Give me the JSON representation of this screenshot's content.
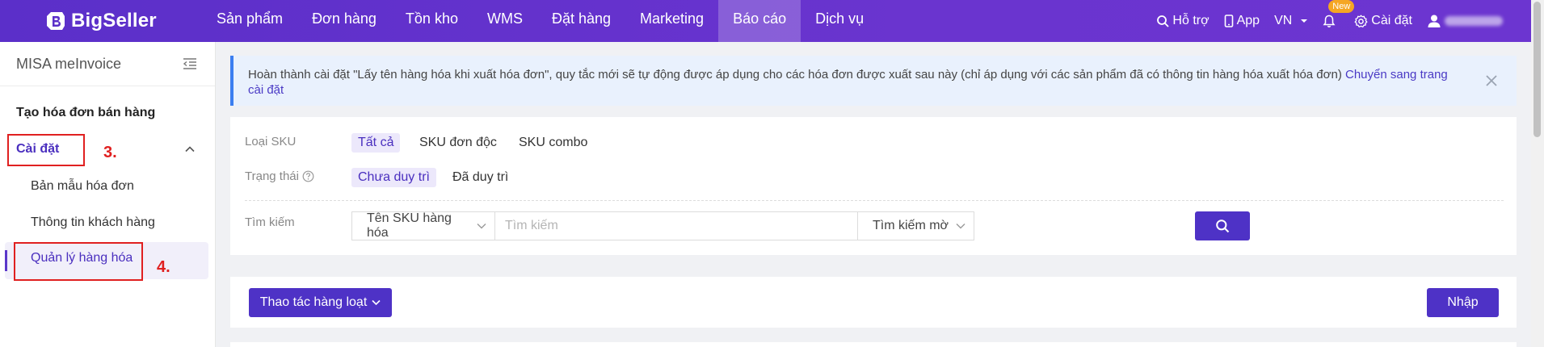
{
  "app": {
    "brand": "BigSeller"
  },
  "nav": {
    "items": [
      "Sản phẩm",
      "Đơn hàng",
      "Tồn kho",
      "WMS",
      "Đặt hàng",
      "Marketing",
      "Báo cáo",
      "Dịch vụ"
    ],
    "active": "Báo cáo"
  },
  "tools": {
    "support": "Hỗ trợ",
    "app": "App",
    "language": "VN",
    "new_badge": "New",
    "settings": "Cài đặt"
  },
  "sidebar": {
    "title": "MISA meInvoice",
    "section": "Tạo hóa đơn bán hàng",
    "group": "Cài đặt",
    "items": [
      "Bản mẫu hóa đơn",
      "Thông tin khách hàng",
      "Quản lý hàng hóa"
    ],
    "active_item": "Quản lý hàng hóa"
  },
  "annotations": {
    "step3": "3.",
    "step4": "4."
  },
  "notice": {
    "text": "Hoàn thành cài đặt \"Lấy tên hàng hóa khi xuất hóa đơn\", quy tắc mới sẽ tự động được áp dụng cho các hóa đơn được xuất sau này (chỉ áp dụng với các sản phẩm đã có thông tin hàng hóa xuất hóa đơn)",
    "link": "Chuyển sang trang cài đặt"
  },
  "filters": {
    "sku_type": {
      "label": "Loại SKU",
      "options": [
        "Tất cả",
        "SKU đơn độc",
        "SKU combo"
      ],
      "selected": "Tất cả"
    },
    "status": {
      "label": "Trạng thái",
      "options": [
        "Chưa duy trì",
        "Đã duy trì"
      ],
      "selected": "Chưa duy trì"
    },
    "search": {
      "label": "Tìm kiếm",
      "field": "Tên SKU hàng hóa",
      "placeholder": "Tìm kiếm",
      "mode": "Tìm kiếm mờ"
    }
  },
  "actions": {
    "bulk": "Thao tác hàng loạt",
    "import": "Nhập"
  },
  "colors": {
    "brand_purple": "#5b2fc9",
    "primary_button": "#4e32c6",
    "annotation_red": "#e02020",
    "notice_blue": "#3b7ef0"
  }
}
